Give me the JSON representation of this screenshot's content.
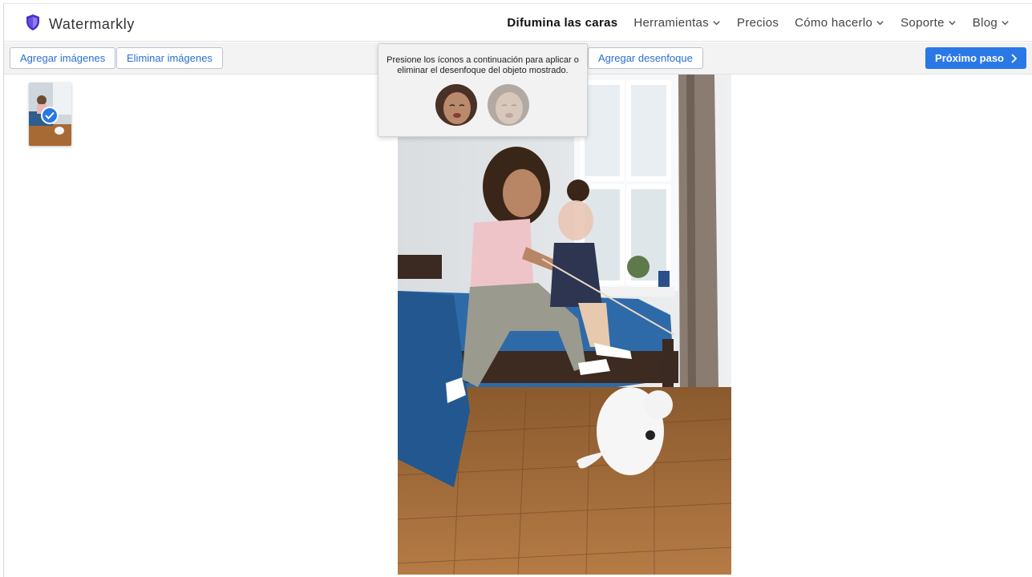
{
  "brand": {
    "name": "Watermarkly",
    "icon": "shield-icon",
    "color": "#5a3fd6"
  },
  "nav": [
    {
      "label": "Difumina las caras",
      "active": true,
      "dropdown": false
    },
    {
      "label": "Herramientas",
      "active": false,
      "dropdown": true
    },
    {
      "label": "Precios",
      "active": false,
      "dropdown": false
    },
    {
      "label": "Cómo hacerlo",
      "active": false,
      "dropdown": true
    },
    {
      "label": "Soporte",
      "active": false,
      "dropdown": true
    },
    {
      "label": "Blog",
      "active": false,
      "dropdown": true
    }
  ],
  "toolbar": {
    "add_images": "Agregar imágenes",
    "remove_images": "Eliminar imágenes",
    "add_blur": "Agregar desenfoque",
    "next_step": "Próximo paso"
  },
  "popover": {
    "text": "Presione los íconos a continuación para aplicar o eliminar el desenfoque del objeto mostrado."
  },
  "colors": {
    "accent": "#2a78e6",
    "link": "#2a6fd1"
  }
}
